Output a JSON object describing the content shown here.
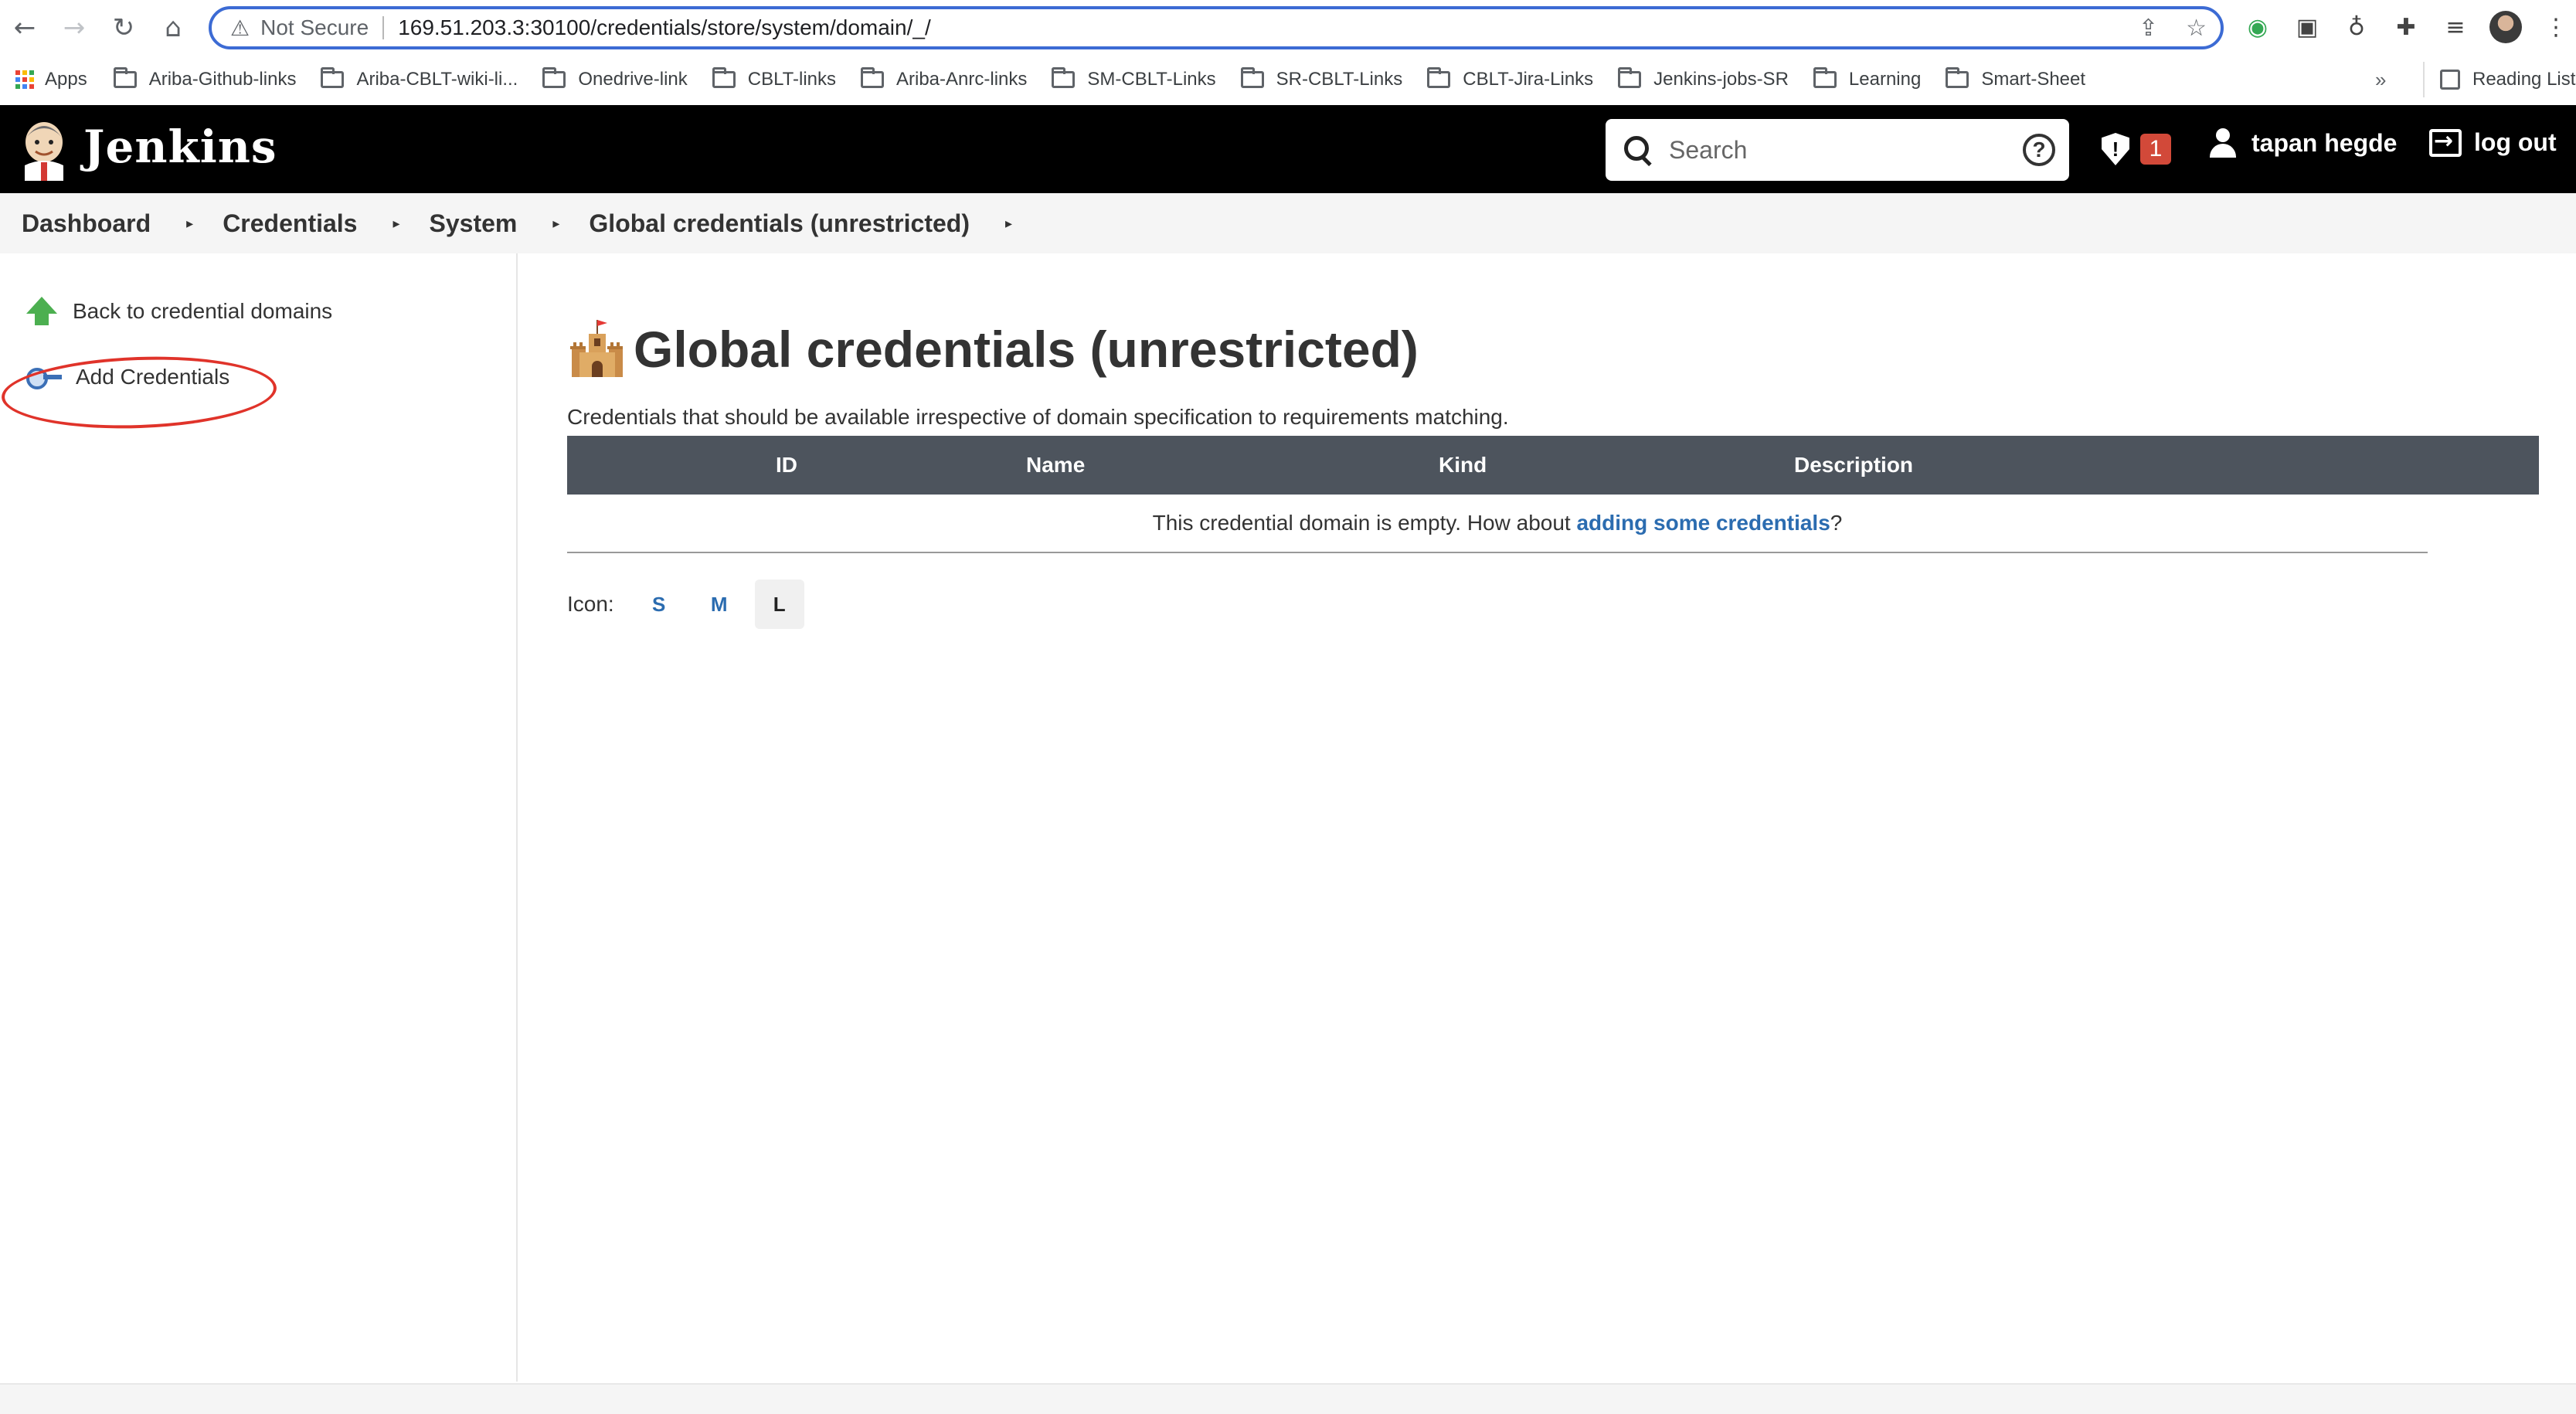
{
  "browser": {
    "security_label": "Not Secure",
    "url": "169.51.203.3:30100/credentials/store/system/domain/_/"
  },
  "bookmarks": {
    "apps_label": "Apps",
    "items": [
      "Ariba-Github-links",
      "Ariba-CBLT-wiki-li...",
      "Onedrive-link",
      "CBLT-links",
      "Ariba-Anrc-links",
      "SM-CBLT-Links",
      "SR-CBLT-Links",
      "CBLT-Jira-Links",
      "Jenkins-jobs-SR",
      "Learning",
      "Smart-Sheet"
    ],
    "overflow": "»",
    "reading_list": "Reading List"
  },
  "header": {
    "brand": "Jenkins",
    "search_placeholder": "Search",
    "help": "?",
    "security_count": "1",
    "user": "tapan hegde",
    "logout": "log out"
  },
  "breadcrumb": [
    "Dashboard",
    "Credentials",
    "System",
    "Global credentials (unrestricted)"
  ],
  "sidebar": {
    "back": "Back to credential domains",
    "add": "Add Credentials"
  },
  "main": {
    "title": "Global credentials (unrestricted)",
    "description": "Credentials that should be available irrespective of domain specification to requirements matching.",
    "columns": [
      "ID",
      "Name",
      "Kind",
      "Description"
    ],
    "empty_prefix": "This credential domain is empty. How about ",
    "empty_link": "adding some credentials",
    "empty_suffix": "?",
    "icon_label": "Icon:",
    "icon_sizes": [
      "S",
      "M",
      "L"
    ],
    "icon_size_selected": "L"
  },
  "colors": {
    "header_bg": "#000000",
    "table_header_bg": "#4d545d",
    "link": "#2b6cb0",
    "badge": "#d24939",
    "annotation": "#e0332a"
  }
}
